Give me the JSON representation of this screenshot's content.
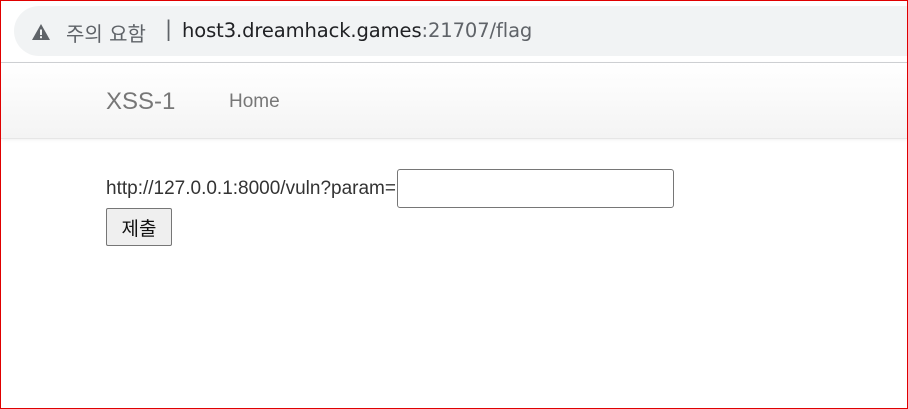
{
  "browser": {
    "security_icon": "warning-triangle-icon",
    "security_label": "주의 요함",
    "separator": "|",
    "url_host": "host3.dreamhack.games",
    "url_rest": ":21707/flag"
  },
  "navbar": {
    "brand": "XSS-1",
    "home": "Home"
  },
  "form": {
    "label": "http://127.0.0.1:8000/vuln?param=",
    "input_value": "",
    "submit_label": "제출"
  },
  "colors": {
    "frame_border": "#e00000",
    "omnibox_bg": "#f1f3f4",
    "nav_text": "#777777"
  }
}
